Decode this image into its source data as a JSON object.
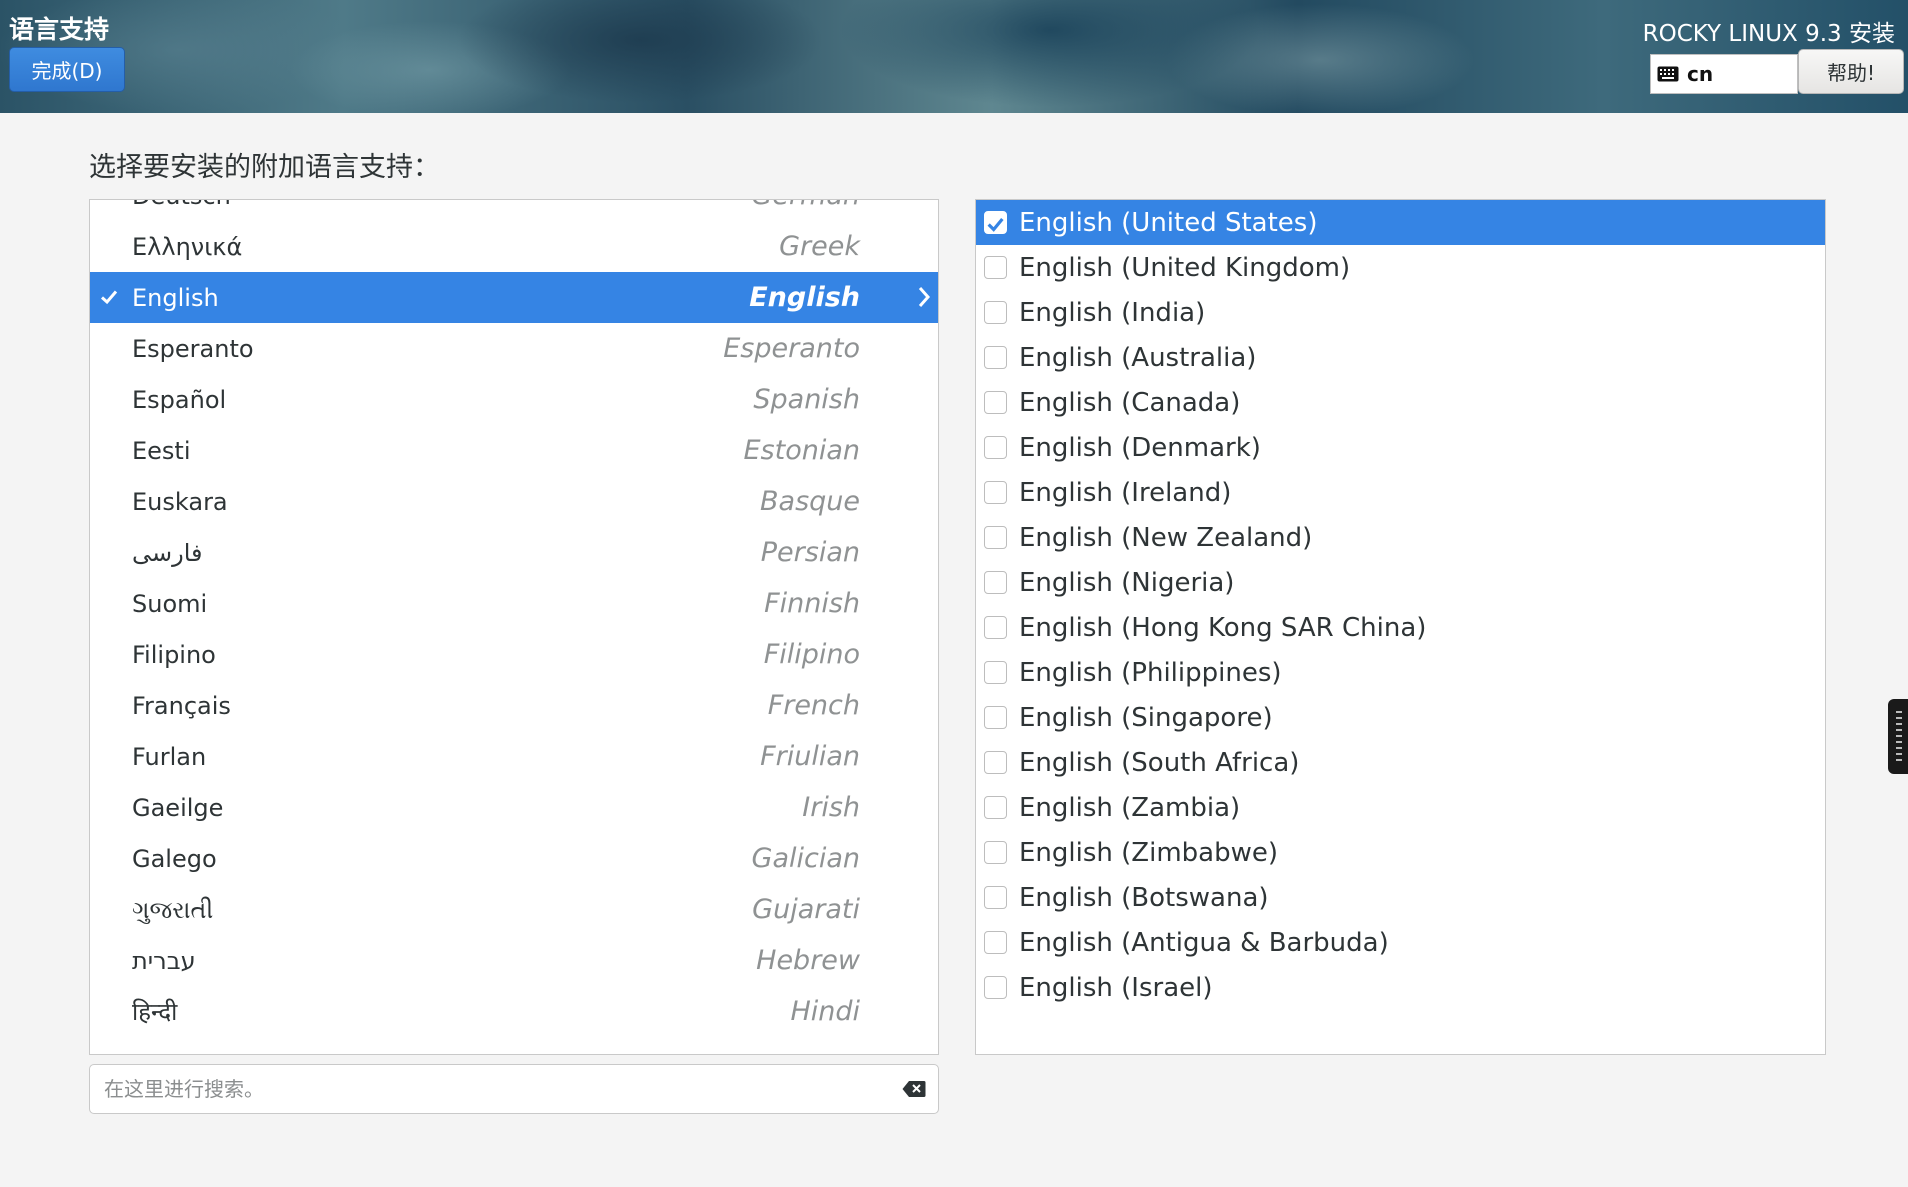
{
  "header": {
    "title": "语言支持",
    "done_label": "完成(D)",
    "product": "ROCKY LINUX 9.3 安装",
    "keyboard_layout": "cn",
    "help_label": "帮助!"
  },
  "prompt": "选择要安装的附加语言支持：",
  "languages": [
    {
      "native": "Deutsch",
      "english": "German"
    },
    {
      "native": "Ελληνικά",
      "english": "Greek"
    },
    {
      "native": "English",
      "english": "English",
      "selected": true
    },
    {
      "native": "Esperanto",
      "english": "Esperanto"
    },
    {
      "native": "Español",
      "english": "Spanish"
    },
    {
      "native": "Eesti",
      "english": "Estonian"
    },
    {
      "native": "Euskara",
      "english": "Basque"
    },
    {
      "native": "فارسی",
      "english": "Persian"
    },
    {
      "native": "Suomi",
      "english": "Finnish"
    },
    {
      "native": "Filipino",
      "english": "Filipino"
    },
    {
      "native": "Français",
      "english": "French"
    },
    {
      "native": "Furlan",
      "english": "Friulian"
    },
    {
      "native": "Gaeilge",
      "english": "Irish"
    },
    {
      "native": "Galego",
      "english": "Galician"
    },
    {
      "native": "ગુજરાતી",
      "english": "Gujarati"
    },
    {
      "native": "עברית",
      "english": "Hebrew"
    },
    {
      "native": "हिन्दी",
      "english": "Hindi"
    }
  ],
  "search": {
    "placeholder": "在这里进行搜索。",
    "value": ""
  },
  "locales": [
    {
      "label": "English (United States)",
      "checked": true
    },
    {
      "label": "English (United Kingdom)",
      "checked": false
    },
    {
      "label": "English (India)",
      "checked": false
    },
    {
      "label": "English (Australia)",
      "checked": false
    },
    {
      "label": "English (Canada)",
      "checked": false
    },
    {
      "label": "English (Denmark)",
      "checked": false
    },
    {
      "label": "English (Ireland)",
      "checked": false
    },
    {
      "label": "English (New Zealand)",
      "checked": false
    },
    {
      "label": "English (Nigeria)",
      "checked": false
    },
    {
      "label": "English (Hong Kong SAR China)",
      "checked": false
    },
    {
      "label": "English (Philippines)",
      "checked": false
    },
    {
      "label": "English (Singapore)",
      "checked": false
    },
    {
      "label": "English (South Africa)",
      "checked": false
    },
    {
      "label": "English (Zambia)",
      "checked": false
    },
    {
      "label": "English (Zimbabwe)",
      "checked": false
    },
    {
      "label": "English (Botswana)",
      "checked": false
    },
    {
      "label": "English (Antigua & Barbuda)",
      "checked": false
    },
    {
      "label": "English (Israel)",
      "checked": false
    }
  ],
  "colors": {
    "accent": "#3584e4",
    "background": "#f4f4f4"
  },
  "icons": {
    "keyboard": "keyboard-icon",
    "check": "checkmark-icon",
    "expand": "chevron-right-icon",
    "clear": "backspace-clear-icon"
  }
}
